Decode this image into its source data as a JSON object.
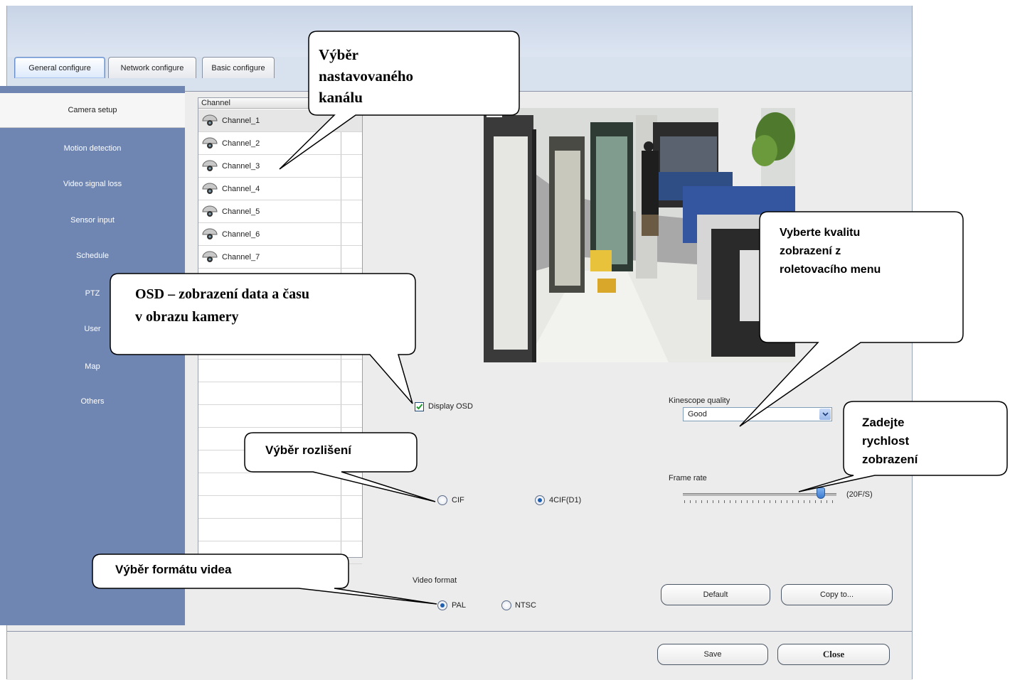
{
  "tabs": [
    "General configure",
    "Network configure",
    "Basic configure"
  ],
  "sidebar": {
    "items": [
      "Camera setup",
      "Motion detection",
      "Video signal loss",
      "Sensor input",
      "Schedule",
      "PTZ",
      "User",
      "Map",
      "Others"
    ]
  },
  "channel_list": {
    "header": "Channel",
    "items": [
      "Channel_1",
      "Channel_2",
      "Channel_3",
      "Channel_4",
      "Channel_5",
      "Channel_6",
      "Channel_7"
    ],
    "selected": "Channel_1"
  },
  "osd": {
    "label": "Display OSD",
    "checked": true
  },
  "resolution": {
    "options": [
      "CIF",
      "4CIF(D1)"
    ],
    "selected": "4CIF(D1)"
  },
  "kinescope": {
    "label": "Kinescope quality",
    "value": "Good"
  },
  "frame_rate": {
    "label": "Frame rate",
    "value_text": "(20F/S)",
    "level": 0.9
  },
  "video_format": {
    "label": "Video format",
    "options": [
      "PAL",
      "NTSC"
    ],
    "selected": "PAL"
  },
  "buttons": {
    "default": "Default",
    "copy": "Copy to...",
    "save": "Save",
    "close": "Close"
  },
  "callouts": {
    "channel_1": "Výběr",
    "channel_2": "nastavovaného",
    "channel_3": "kanálu",
    "osd_1": "OSD – zobrazení data a času",
    "osd_2": "v obrazu kamery",
    "quality_1": "Vyberte kvalitu",
    "quality_2": "zobrazení z",
    "quality_3": "roletovacího menu",
    "resolution": "Výběr rozlišení",
    "framerate_1": "Zadejte",
    "framerate_2": "rychlost",
    "framerate_3": "zobrazení",
    "format": "Výběr formátu videa"
  },
  "colors": {
    "sidebar": "#6f86b3",
    "window": "#d2dced",
    "content": "#ececec",
    "accent": "#1f5fb0"
  }
}
